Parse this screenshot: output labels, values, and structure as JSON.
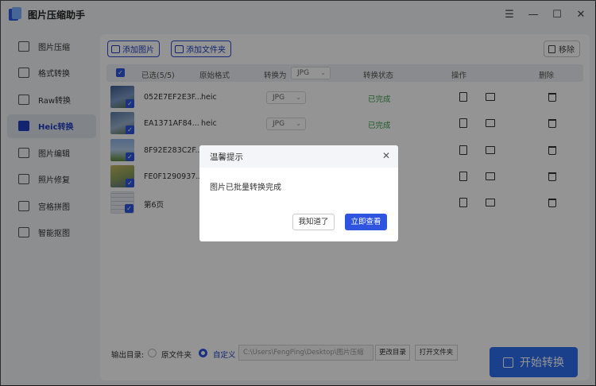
{
  "app": {
    "title": "图片压缩助手"
  },
  "window_controls": {
    "menu": "☰",
    "minimize": "—",
    "maximize": "☐",
    "close": "✕"
  },
  "sidebar": {
    "items": [
      {
        "label": "图片压缩",
        "active": false
      },
      {
        "label": "格式转换",
        "active": false
      },
      {
        "label": "Raw转换",
        "active": false
      },
      {
        "label": "Heic转换",
        "active": true
      },
      {
        "label": "图片编辑",
        "active": false
      },
      {
        "label": "照片修复",
        "active": false
      },
      {
        "label": "宫格拼图",
        "active": false
      },
      {
        "label": "智能抠图",
        "active": false
      }
    ]
  },
  "toolbar": {
    "add_image": "添加图片",
    "add_folder": "添加文件夹",
    "remove": "移除"
  },
  "table": {
    "headers": {
      "selected": "已选(5/5)",
      "original_format": "原始格式",
      "convert_to": "转换为",
      "convert_to_value": "JPG",
      "status": "转换状态",
      "actions": "操作",
      "delete": "删除"
    },
    "rows": [
      {
        "name": "052E7EF2E3F...",
        "format": "heic",
        "target": "JPG",
        "status": "已完成",
        "thumb": "#5a7fb0"
      },
      {
        "name": "EA1371AF84...",
        "format": "heic",
        "target": "JPG",
        "status": "已完成",
        "thumb": "#6f8fb8"
      },
      {
        "name": "8F92E283C2F...",
        "format": "",
        "target": "",
        "status": "",
        "thumb": "#7fa6d6"
      },
      {
        "name": "FE0F1290937...",
        "format": "",
        "target": "",
        "status": "",
        "thumb": "#9aa860"
      },
      {
        "name": "第6页",
        "format": "",
        "target": "",
        "status": "",
        "thumb": "#e8eaf0"
      }
    ]
  },
  "footer": {
    "output_label": "输出目录:",
    "option_original": "原文件夹",
    "option_custom": "自定义",
    "path": "C:\\Users\\FengPing\\Desktop\\图片压缩",
    "change_dir": "更改目录",
    "open_folder": "打开文件夹",
    "start": "开始转换"
  },
  "dialog": {
    "title": "温馨提示",
    "close": "✕",
    "message": "图片已批量转换完成",
    "btn_ok": "我知道了",
    "btn_view": "立即查看"
  },
  "colors": {
    "accent": "#2f55e0",
    "status_done": "#3aa14c",
    "start_button": "#2f6ff0"
  }
}
